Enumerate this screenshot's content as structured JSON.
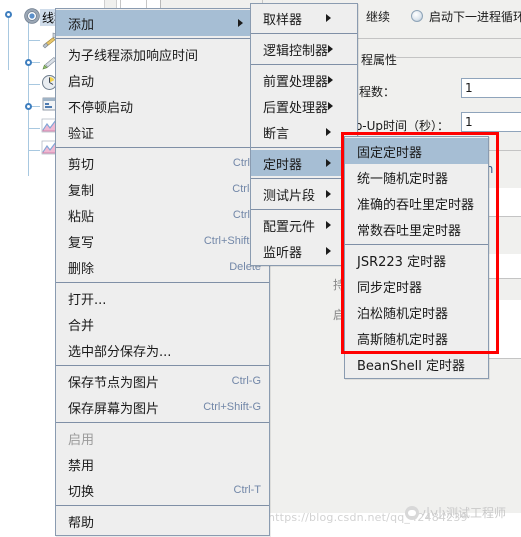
{
  "window": {
    "tree": {
      "root_label": "线程组",
      "nodes": [
        {
          "icon": "tools-icon",
          "label": ""
        },
        {
          "icon": "pencil-icon",
          "label": ""
        },
        {
          "icon": "timer-clock-icon",
          "label": ""
        },
        {
          "icon": "config-element-icon",
          "label": ""
        },
        {
          "icon": "graph-results-icon",
          "label": ""
        },
        {
          "icon": "graph-results-icon",
          "label": ""
        }
      ]
    },
    "content": {
      "continue_label": "继续",
      "start_next_loop_label": "启动下一进程循环",
      "group_title": "程属性",
      "thread_count_label": "程数：",
      "thread_count_value": "1",
      "rampup_label": "mp-Up时间（秒）：",
      "rampup_value": "1",
      "duration_label_partial": "持",
      "start_label_partial": "启",
      "right_text_fragment": "ation"
    },
    "watermark": {
      "url": "https://blog.csdn.net/qq_42484239",
      "brand": "小小测试工程师"
    }
  },
  "menus": {
    "main": {
      "name": "node-context-menu",
      "items": [
        {
          "label": "添加",
          "accel": "",
          "submenu": true,
          "selected": true,
          "disabled": false
        },
        {
          "separator": true
        },
        {
          "label": "为子线程添加响应时间",
          "accel": "",
          "submenu": false,
          "selected": false,
          "disabled": false
        },
        {
          "label": "启动",
          "accel": "",
          "submenu": false,
          "selected": false,
          "disabled": false
        },
        {
          "label": "不停顿启动",
          "accel": "",
          "submenu": false,
          "selected": false,
          "disabled": false
        },
        {
          "label": "验证",
          "accel": "",
          "submenu": false,
          "selected": false,
          "disabled": false
        },
        {
          "separator": true
        },
        {
          "label": "剪切",
          "accel": "Ctrl-X",
          "submenu": false,
          "selected": false,
          "disabled": false
        },
        {
          "label": "复制",
          "accel": "Ctrl-C",
          "submenu": false,
          "selected": false,
          "disabled": false
        },
        {
          "label": "粘贴",
          "accel": "Ctrl-V",
          "submenu": false,
          "selected": false,
          "disabled": false
        },
        {
          "label": "复写",
          "accel": "Ctrl+Shift-C",
          "submenu": false,
          "selected": false,
          "disabled": false
        },
        {
          "label": "删除",
          "accel": "Delete",
          "submenu": false,
          "selected": false,
          "disabled": false
        },
        {
          "separator": true
        },
        {
          "label": "打开...",
          "accel": "",
          "submenu": false,
          "selected": false,
          "disabled": false
        },
        {
          "label": "合并",
          "accel": "",
          "submenu": false,
          "selected": false,
          "disabled": false
        },
        {
          "label": "选中部分保存为...",
          "accel": "",
          "submenu": false,
          "selected": false,
          "disabled": false
        },
        {
          "separator": true
        },
        {
          "label": "保存节点为图片",
          "accel": "Ctrl-G",
          "submenu": false,
          "selected": false,
          "disabled": false
        },
        {
          "label": "保存屏幕为图片",
          "accel": "Ctrl+Shift-G",
          "submenu": false,
          "selected": false,
          "disabled": false
        },
        {
          "separator": true
        },
        {
          "label": "启用",
          "accel": "",
          "submenu": false,
          "selected": false,
          "disabled": true
        },
        {
          "label": "禁用",
          "accel": "",
          "submenu": false,
          "selected": false,
          "disabled": false
        },
        {
          "label": "切换",
          "accel": "Ctrl-T",
          "submenu": false,
          "selected": false,
          "disabled": false
        },
        {
          "separator": true
        },
        {
          "label": "帮助",
          "accel": "",
          "submenu": false,
          "selected": false,
          "disabled": false
        }
      ]
    },
    "add": {
      "name": "add-submenu",
      "items": [
        {
          "label": "取样器",
          "submenu": true,
          "selected": false
        },
        {
          "separator": true
        },
        {
          "label": "逻辑控制器",
          "submenu": true,
          "selected": false
        },
        {
          "separator": true
        },
        {
          "label": "前置处理器",
          "submenu": true,
          "selected": false
        },
        {
          "label": "后置处理器",
          "submenu": true,
          "selected": false
        },
        {
          "label": "断言",
          "submenu": true,
          "selected": false
        },
        {
          "separator": true
        },
        {
          "label": "定时器",
          "submenu": true,
          "selected": true
        },
        {
          "separator": true
        },
        {
          "label": "测试片段",
          "submenu": true,
          "selected": false
        },
        {
          "separator": true
        },
        {
          "label": "配置元件",
          "submenu": true,
          "selected": false
        },
        {
          "label": "监听器",
          "submenu": true,
          "selected": false
        }
      ]
    },
    "timer": {
      "name": "timer-submenu",
      "items": [
        {
          "label": "固定定时器",
          "selected": true
        },
        {
          "label": "统一随机定时器",
          "selected": false
        },
        {
          "label": "准确的吞吐里定时器",
          "selected": false
        },
        {
          "label": "常数吞吐里定时器",
          "selected": false
        },
        {
          "separator": true
        },
        {
          "label": "JSR223 定时器",
          "selected": false
        },
        {
          "label": "同步定时器",
          "selected": false
        },
        {
          "label": "泊松随机定时器",
          "selected": false
        },
        {
          "label": "高斯随机定时器",
          "selected": false
        },
        {
          "label": "BeanShell 定时器",
          "selected": false
        }
      ]
    }
  },
  "annotation": {
    "highlight_color": "#ff0000",
    "selection_color": "#a6bed4"
  }
}
